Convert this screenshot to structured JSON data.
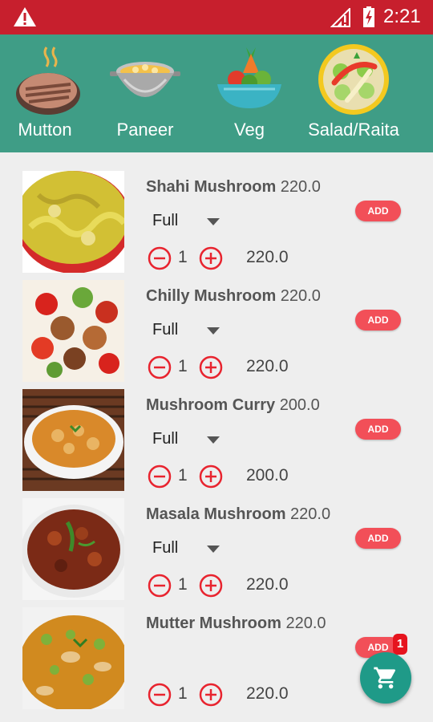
{
  "status_bar": {
    "time": "2:21"
  },
  "categories": [
    {
      "label": "Mutton",
      "icon": "mutton-icon"
    },
    {
      "label": "Paneer",
      "icon": "paneer-bowl-icon"
    },
    {
      "label": "Veg",
      "icon": "veg-bowl-icon"
    },
    {
      "label": "Salad/Raita",
      "icon": "salad-plate-icon"
    }
  ],
  "items": [
    {
      "name": "Shahi Mushroom",
      "price_label": "220.0",
      "portion": "Full",
      "quantity": "1",
      "total": "220.0",
      "add_label": "ADD"
    },
    {
      "name": "Chilly Mushroom",
      "price_label": "220.0",
      "portion": "Full",
      "quantity": "1",
      "total": "220.0",
      "add_label": "ADD"
    },
    {
      "name": "Mushroom Curry",
      "price_label": "200.0",
      "portion": "Full",
      "quantity": "1",
      "total": "200.0",
      "add_label": "ADD"
    },
    {
      "name": "Masala Mushroom",
      "price_label": "220.0",
      "portion": "Full",
      "quantity": "1",
      "total": "220.0",
      "add_label": "ADD"
    },
    {
      "name": "Mutter Mushroom",
      "price_label": "220.0",
      "portion": "",
      "quantity": "1",
      "total": "220.0",
      "add_label": "ADD"
    }
  ],
  "cart": {
    "count": "1"
  },
  "colors": {
    "status_bar": "#c71f2d",
    "category_bar": "#3f9d86",
    "add_button": "#f24f58",
    "stepper": "#e8242f",
    "fab": "#1f9a88"
  }
}
